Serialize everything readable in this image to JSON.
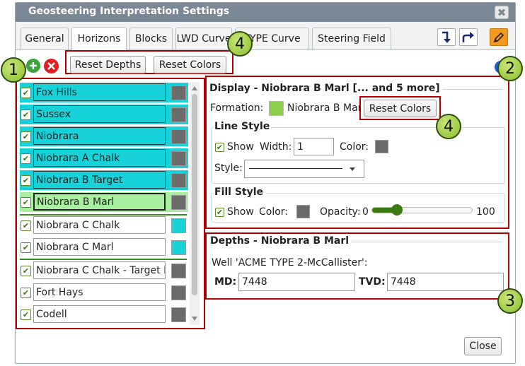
{
  "dialog": {
    "title": "Geosteering Interpretation Settings",
    "close_glyph": "✖",
    "close_button": "Close"
  },
  "tabs": [
    "General",
    "Horizons",
    "Blocks",
    "LWD Curve",
    "TYPE Curve",
    "Steering Field"
  ],
  "active_tab": "Horizons",
  "toolbar_icons": [
    "import-down-icon",
    "share-arrow-icon",
    "edit-pencil-icon"
  ],
  "actions": {
    "add_icon": "plus-circle-icon",
    "delete_icon": "x-circle-icon",
    "reset_depths": "Reset Depths",
    "reset_colors": "Reset Colors"
  },
  "horizons": [
    {
      "name": "Fox Hills",
      "highlight": "#17d2d8",
      "swatch": "#6b6b6b"
    },
    {
      "name": "Sussex",
      "highlight": "#17d2d8",
      "swatch": "#6b6b6b"
    },
    {
      "name": "Niobrara",
      "highlight": "#17d2d8",
      "swatch": "#6b6b6b"
    },
    {
      "name": "Niobrara A Chalk",
      "highlight": "#17d2d8",
      "swatch": "#6b6b6b"
    },
    {
      "name": "Niobrara B Target",
      "highlight": "#17d2d8",
      "swatch": "#6b6b6b"
    },
    {
      "name": "Niobrara B Marl",
      "highlight": "#a8f0a0",
      "swatch": "#6b6b6b"
    },
    {
      "name": "Niobrara C Chalk",
      "highlight": "",
      "swatch": "#17d2d8"
    },
    {
      "name": "Niobrara C Marl",
      "highlight": "",
      "swatch": "#17d2d8"
    },
    {
      "name": "Niobrara C Chalk - Target I",
      "highlight": "",
      "swatch": "#6b6b6b"
    },
    {
      "name": "Fort Hays",
      "highlight": "",
      "swatch": "#6b6b6b"
    },
    {
      "name": "Codell",
      "highlight": "",
      "swatch": "#6b6b6b"
    }
  ],
  "display": {
    "header": "Display - Niobrara B Marl [... and 5 more]",
    "formation_label": "Formation:",
    "formation_name": "Niobrara B Marl",
    "formation_color": "#8fd14f",
    "reset_colors": "Reset Colors",
    "line_style": {
      "legend": "Line Style",
      "show_label": "Show",
      "width_label": "Width:",
      "width_value": "1",
      "color_label": "Color:",
      "color": "#6b6b6b",
      "style_label": "Style:"
    },
    "fill_style": {
      "legend": "Fill Style",
      "show_label": "Show",
      "color_label": "Color:",
      "color": "#6b6b6b",
      "opacity_label": "Opacity:",
      "opacity_min": "0",
      "opacity_max": "100",
      "opacity_value": 25
    }
  },
  "depths": {
    "header": "Depths - Niobrara B Marl",
    "well_label": "Well 'ACME TYPE 2-McCallister':",
    "md_label": "MD:",
    "md_value": "7448",
    "tvd_label": "TVD:",
    "tvd_value": "7448"
  },
  "callouts": {
    "c1": "1",
    "c2": "2",
    "c3": "3",
    "c4a": "4",
    "c4b": "4"
  },
  "colors": {
    "highlight_red": "#b00000",
    "accent_blue": "#1a5fd0",
    "titlebar": "#7a8794"
  }
}
